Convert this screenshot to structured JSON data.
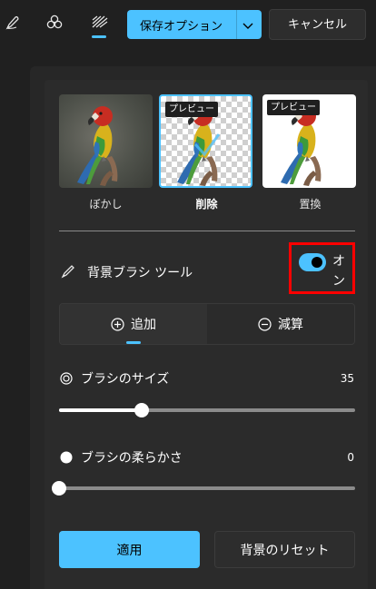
{
  "toolbar": {
    "tools": [
      {
        "icon": "pen-icon"
      },
      {
        "icon": "filter-icon"
      },
      {
        "icon": "background-icon"
      }
    ],
    "save_label": "保存オプション",
    "cancel_label": "キャンセル"
  },
  "options": [
    {
      "label": "ぼかし",
      "badge": ""
    },
    {
      "label": "削除",
      "badge": "プレビュー"
    },
    {
      "label": "置換",
      "badge": "プレビュー"
    }
  ],
  "brush_tool": {
    "label": "背景ブラシ ツール",
    "toggle_text": "オン",
    "on": true
  },
  "modes": {
    "add_label": "追加",
    "subtract_label": "減算",
    "selected": "add"
  },
  "size": {
    "label": "ブラシのサイズ",
    "value": "35",
    "fraction": 0.28
  },
  "softness": {
    "label": "ブラシの柔らかさ",
    "value": "0",
    "fraction": 0
  },
  "actions": {
    "apply_label": "適用",
    "reset_label": "背景のリセット"
  },
  "colors": {
    "accent": "#4cc2ff",
    "highlight": "#ff0000"
  }
}
